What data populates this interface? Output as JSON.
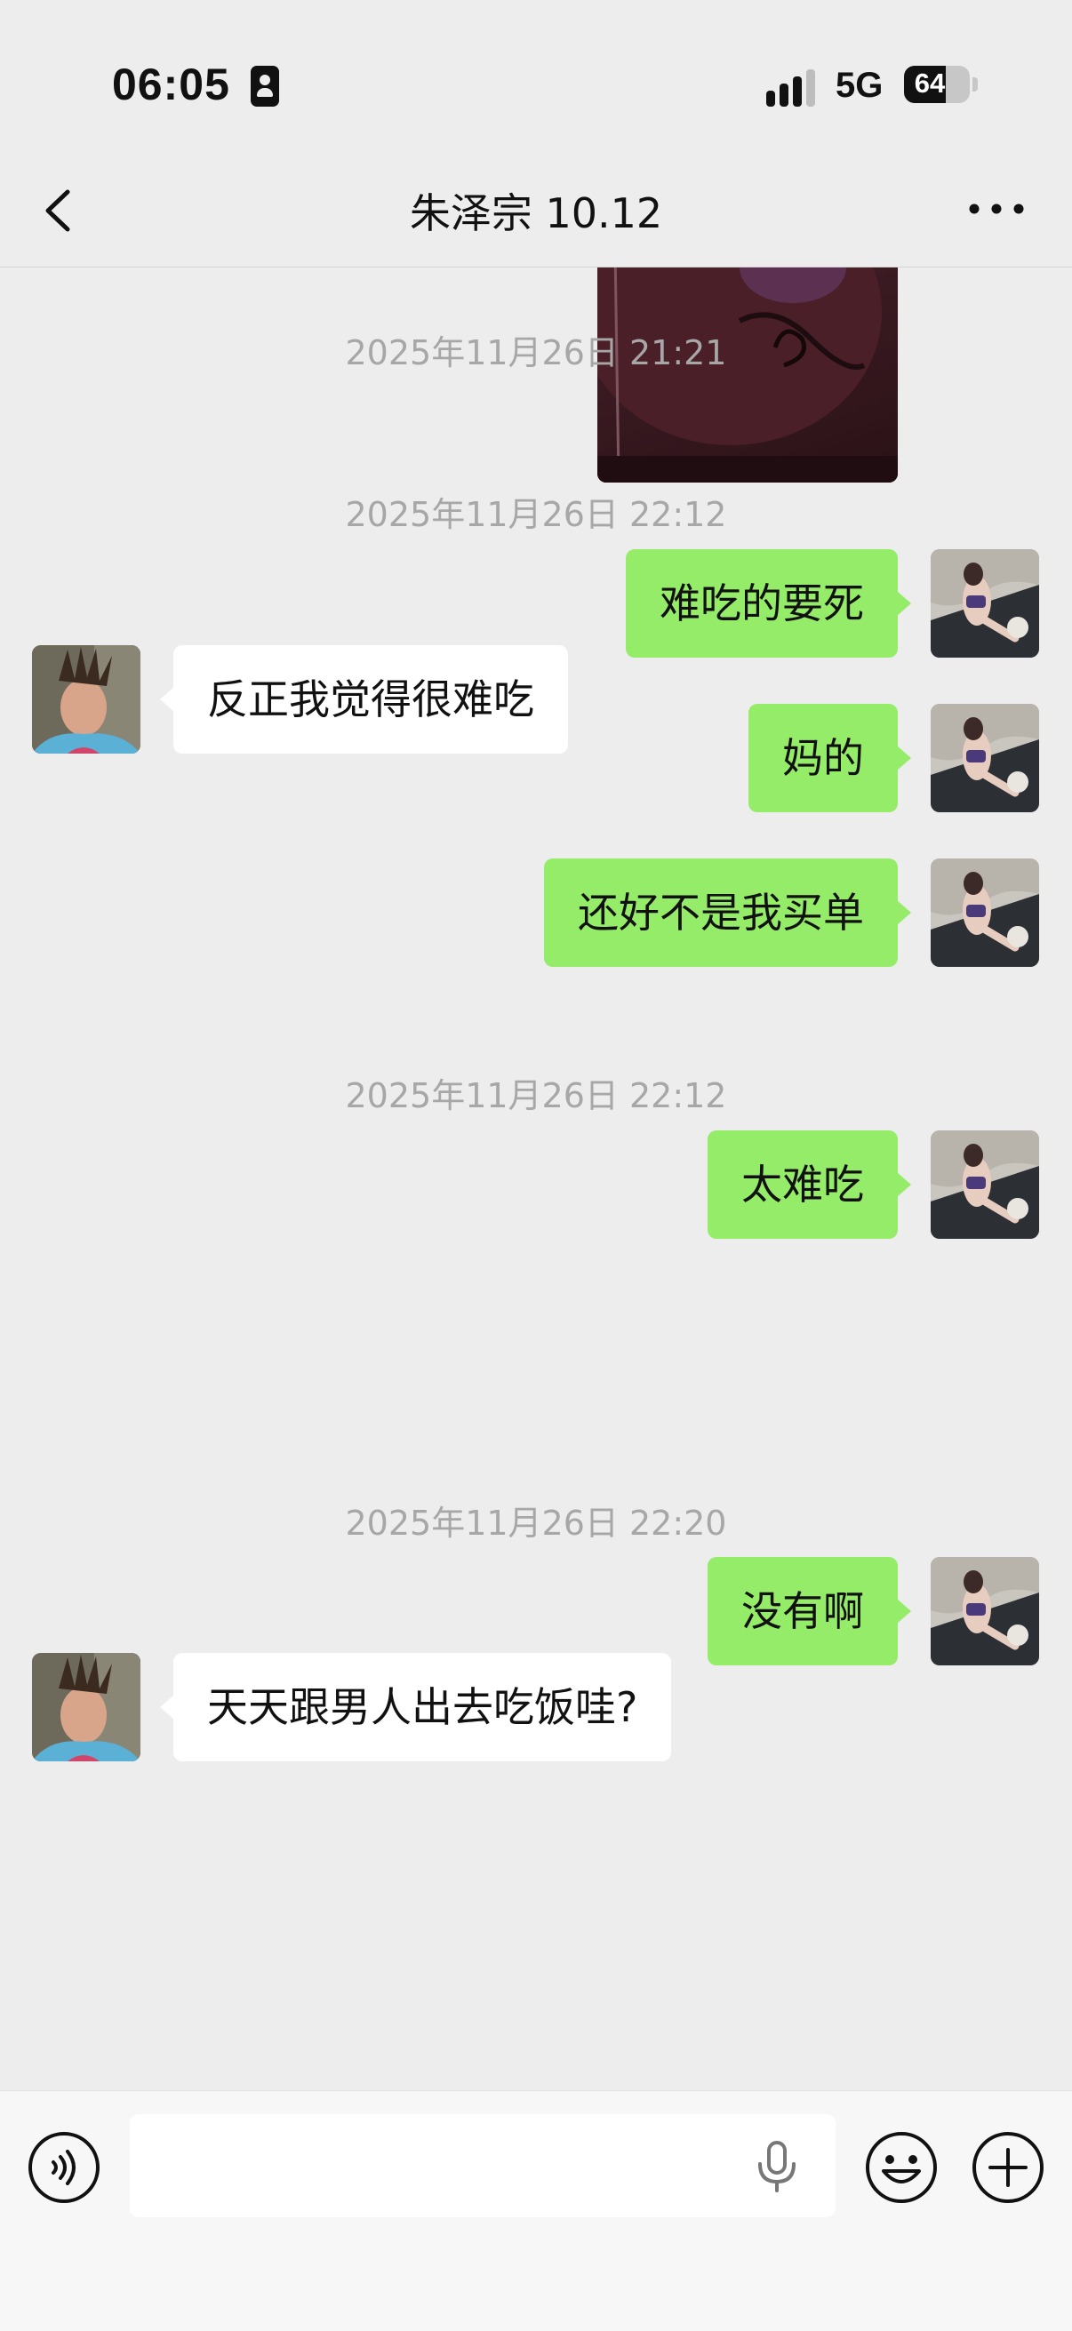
{
  "status_bar": {
    "time": "06:05",
    "network": "5G",
    "battery_level": 64,
    "battery_label": "64"
  },
  "header": {
    "title": "朱泽宗 10.12"
  },
  "messages": [
    {
      "type": "image",
      "side": "right"
    },
    {
      "type": "time",
      "text": "2025年11月26日 21:21"
    },
    {
      "type": "text",
      "side": "left",
      "text": "反正我觉得很难吃"
    },
    {
      "type": "time",
      "text": "2025年11月26日 22:12"
    },
    {
      "type": "text",
      "side": "right",
      "text": "难吃的要死"
    },
    {
      "type": "text",
      "side": "right",
      "text": "妈的"
    },
    {
      "type": "text",
      "side": "right",
      "text": "还好不是我买单"
    },
    {
      "type": "time",
      "text": "2025年11月26日 22:12"
    },
    {
      "type": "text",
      "side": "right",
      "text": "太难吃"
    },
    {
      "type": "text",
      "side": "left",
      "text": "天天跟男人出去吃饭哇?"
    },
    {
      "type": "time",
      "text": "2025年11月26日 22:20"
    },
    {
      "type": "text",
      "side": "right",
      "text": "没有啊"
    }
  ],
  "input_bar": {
    "value": "",
    "icons": [
      "voice-icon",
      "microphone-icon",
      "emoji-icon",
      "plus-icon"
    ]
  },
  "colors": {
    "background": "#ededed",
    "outgoing_bubble": "#95ec69",
    "incoming_bubble": "#ffffff",
    "timestamp": "#a7a7a7"
  }
}
